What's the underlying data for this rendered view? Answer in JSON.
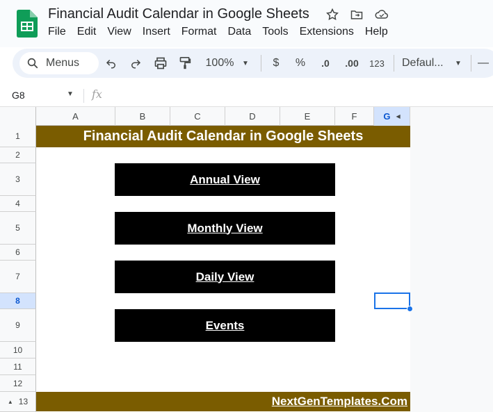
{
  "header": {
    "doc_title": "Financial Audit Calendar in Google Sheets",
    "menus": [
      "File",
      "Edit",
      "View",
      "Insert",
      "Format",
      "Data",
      "Tools",
      "Extensions",
      "Help"
    ]
  },
  "toolbar": {
    "search_label": "Menus",
    "zoom": "100%",
    "currency": "$",
    "percent": "%",
    "decrease_decimal": ".0",
    "increase_decimal": ".00",
    "number_format": "123",
    "font": "Defaul...",
    "minus": "—"
  },
  "formula_bar": {
    "name_box": "G8",
    "fx": "fx"
  },
  "grid": {
    "columns": [
      "A",
      "B",
      "C",
      "D",
      "E",
      "F",
      "G"
    ],
    "selected_column": "G",
    "rows": [
      "1",
      "2",
      "3",
      "4",
      "5",
      "6",
      "7",
      "8",
      "9",
      "10",
      "11",
      "12",
      "13"
    ],
    "selected_row": "8"
  },
  "sheet": {
    "banner_title": "Financial Audit Calendar in Google Sheets",
    "buttons": [
      "Annual View",
      "Monthly View",
      "Daily View",
      "Events"
    ],
    "footer_link": "NextGenTemplates.Com"
  },
  "colors": {
    "banner": "#7a5c00",
    "button": "#000000",
    "selection": "#1a73e8"
  }
}
